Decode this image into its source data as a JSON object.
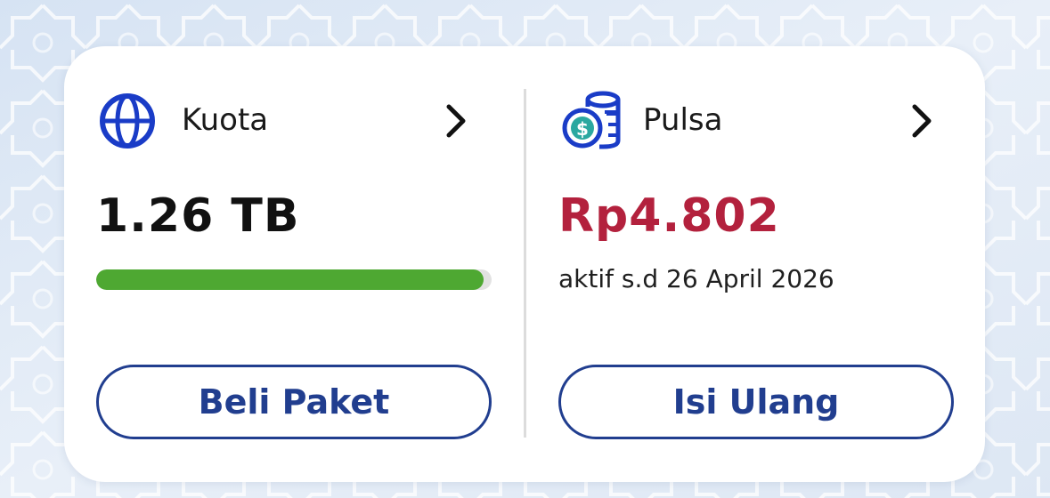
{
  "colors": {
    "primary_blue": "#213e8f",
    "icon_blue": "#1a3cc7",
    "credit_red": "#b3213d",
    "progress_green": "#4ea832",
    "progress_track": "#e2e2e2",
    "coin_teal": "#2ba8a0"
  },
  "quota": {
    "icon": "globe-icon",
    "label": "Kuota",
    "value": "1.26 TB",
    "progress_fraction": 0.98,
    "button_label": "Beli Paket"
  },
  "credit": {
    "icon": "coins-icon",
    "label": "Pulsa",
    "value": "Rp4.802",
    "expiry": "aktif s.d 26 April 2026",
    "button_label": "Isi Ulang"
  }
}
